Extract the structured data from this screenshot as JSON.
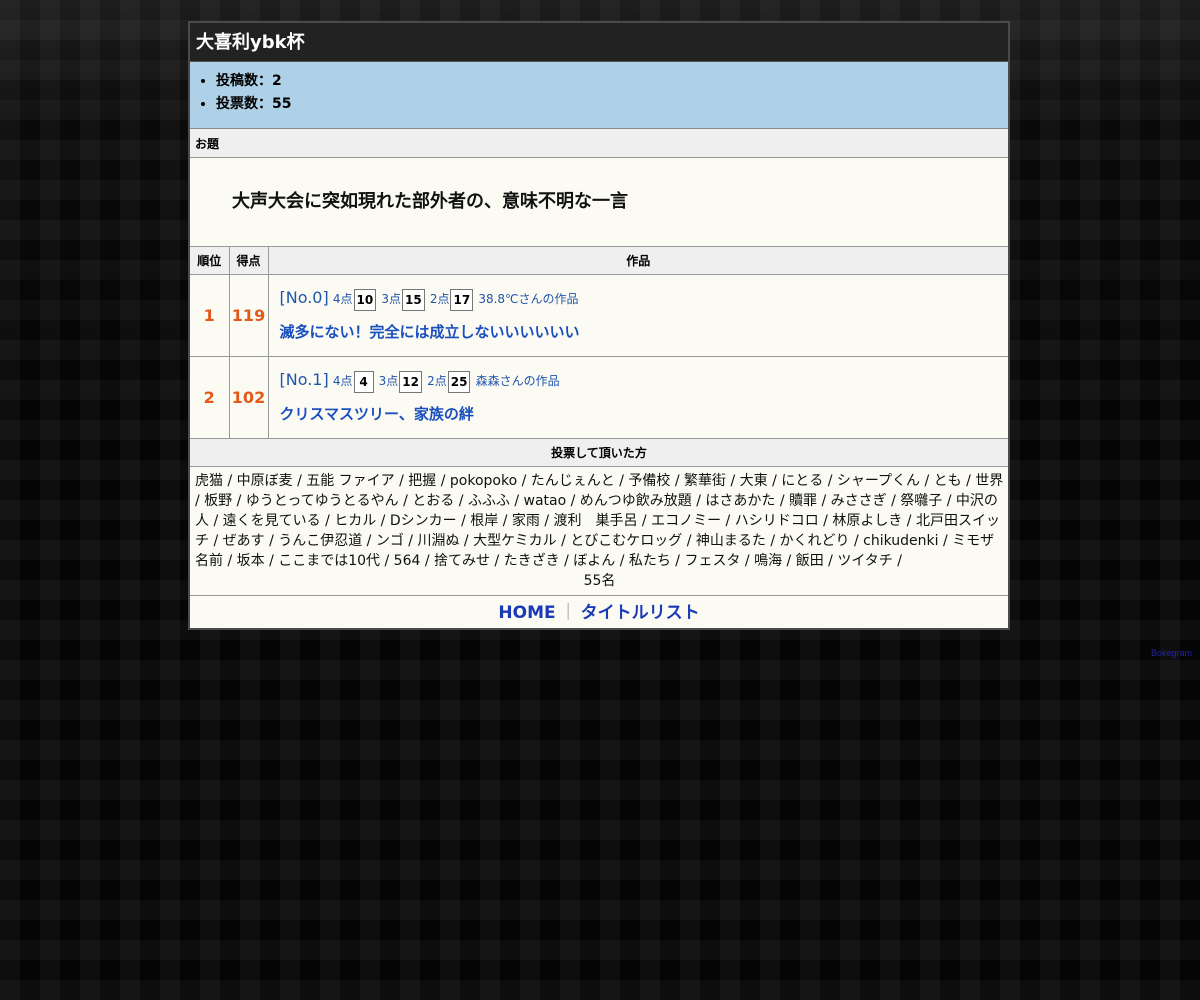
{
  "title": "大喜利ybk杯",
  "stats": {
    "posts": "投稿数：2",
    "votes": "投票数：55"
  },
  "odai": {
    "label": "お題",
    "text": "大声大会に突如現れた部外者の、意味不明な一言"
  },
  "table": {
    "headers": {
      "rank": "順位",
      "score": "得点",
      "work": "作品"
    },
    "rows": [
      {
        "rank": "1",
        "score": "119",
        "no": "[No.0]",
        "pt4_label": "4点",
        "pt4": "10",
        "pt3_label": "3点",
        "pt3": "15",
        "pt2_label": "2点",
        "pt2": "17",
        "author": "38.8℃さんの作品",
        "text": "滅多にない！完全には成立しないいいいいい"
      },
      {
        "rank": "2",
        "score": "102",
        "no": "[No.1]",
        "pt4_label": "4点",
        "pt4": "4",
        "pt3_label": "3点",
        "pt3": "12",
        "pt2_label": "2点",
        "pt2": "25",
        "author": "森森さんの作品",
        "text": "クリスマスツリー、家族の絆"
      }
    ]
  },
  "voters": {
    "label": "投票して頂いた方",
    "list": "虎猫 / 中原ぼ麦 / 五能 ファイア / 把握 / pokopoko / たんじぇんと / 予備校 / 繁華街 / 大東 / にとる / シャープくん / とも / 世界 / 板野 / ゆうとってゆうとるやん / とおる / ふふふ / watao / めんつゆ飲み放題 / はさあかた / 贖罪 / みささぎ / 祭囃子 / 中沢の人 / 遠くを見ている / ヒカル / Dシンカー / 根岸 / 家雨 / 渡利　巣手呂 / エコノミー / ハシリドコロ / 林原よしき / 北戸田スイッチ / ぜあす / うんこ伊忍道 / ンゴ / 川淵ぬ / 大型ケミカル / とびこむケロッグ / 神山まるた / かくれどり / chikudenki / ミモザ名前 / 坂本 / ここまでは10代 / 564 / 捨てみせ / たきざき / ぼよん / 私たち / フェスタ / 鳴海 / 飯田 / ツイタチ /",
    "count": "55名"
  },
  "footer": {
    "home": "HOME",
    "separator": "｜",
    "title_list": "タイトルリスト"
  },
  "credit": "Bokegram",
  "colors": {
    "title_bar": "#222222",
    "stats_bg": "#afd1e8",
    "rank_color": "#e15a1a",
    "entry_text": "#1a4fc0",
    "link": "#1a3bb5"
  }
}
